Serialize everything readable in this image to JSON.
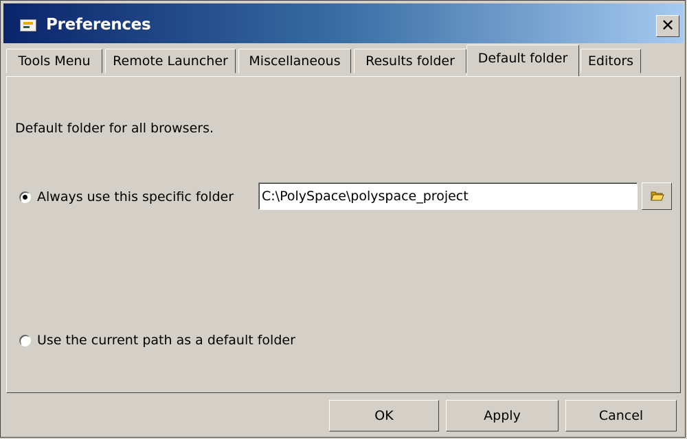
{
  "window": {
    "title": "Preferences",
    "close_label": "✕"
  },
  "tabs": [
    {
      "label": "Tools Menu",
      "active": false
    },
    {
      "label": "Remote Launcher",
      "active": false
    },
    {
      "label": "Miscellaneous",
      "active": false
    },
    {
      "label": "Results folder",
      "active": false
    },
    {
      "label": "Default folder",
      "active": true
    },
    {
      "label": "Editors",
      "active": false
    }
  ],
  "panel": {
    "description": "Default folder for all browsers.",
    "option_specific": {
      "label": "Always use this specific folder",
      "checked": true
    },
    "folder_path": "C:\\PolySpace\\polyspace_project",
    "option_current": {
      "label": "Use the current path as a default folder",
      "checked": false
    },
    "browse_icon": "folder-open-icon"
  },
  "buttons": {
    "ok": "OK",
    "apply": "Apply",
    "cancel": "Cancel"
  },
  "colors": {
    "titlebar_start": "#0a246a",
    "titlebar_end": "#a6caf0",
    "face": "#d4d0c8"
  }
}
